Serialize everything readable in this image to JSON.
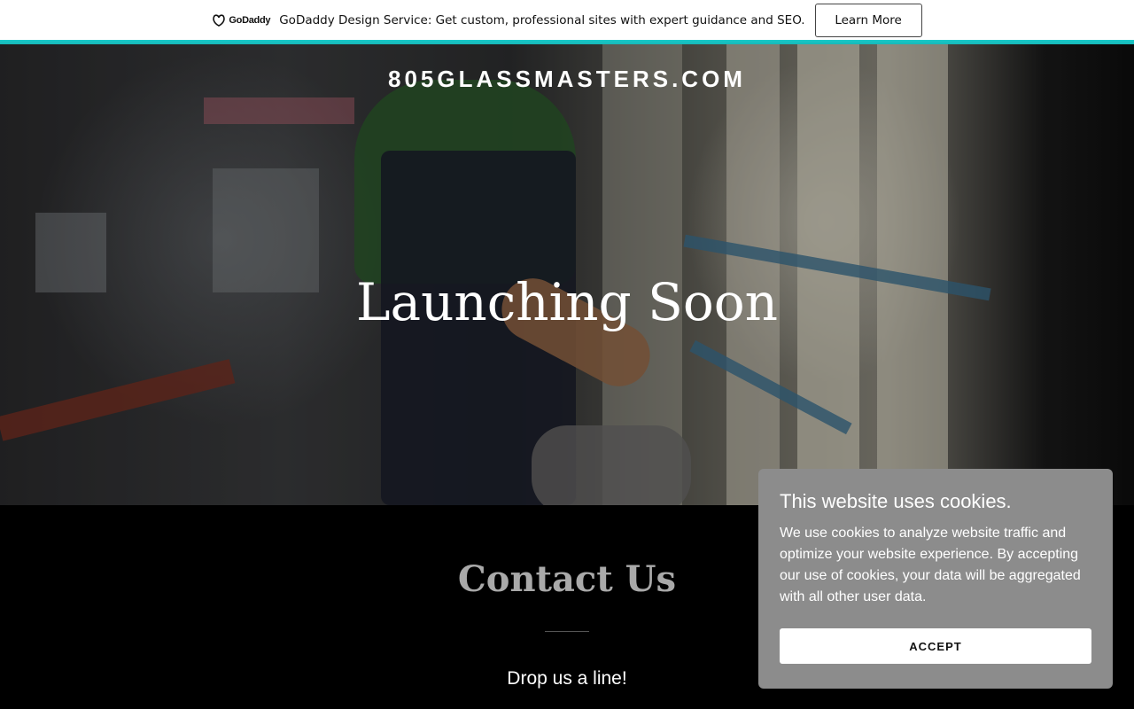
{
  "promo": {
    "logo_text": "GoDaddy",
    "logo_icon": "godaddy-logo-icon",
    "message": "GoDaddy Design Service: Get custom, professional sites with expert guidance and SEO.",
    "button_label": "Learn More"
  },
  "hero": {
    "site_name": "805GLASSMASTERS.COM",
    "title": "Launching Soon",
    "image": "worker-handling-glass-panes"
  },
  "contact": {
    "title": "Contact Us",
    "subtitle": "Drop us a line!"
  },
  "cookie_banner": {
    "title": "This website uses cookies.",
    "body": "We use cookies to analyze website traffic and optimize your website experience. By accepting our use of cookies, your data will be aggregated with all other user data.",
    "accept_label": "ACCEPT"
  },
  "colors": {
    "accent": "#17b8b8",
    "cookie_bg": "#8c8c8c",
    "background": "#000000"
  }
}
